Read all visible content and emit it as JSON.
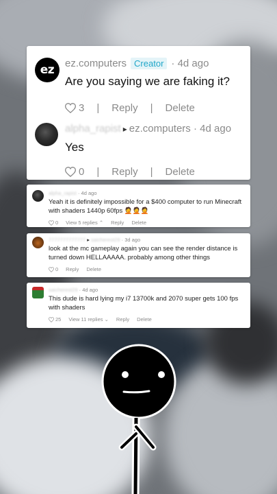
{
  "main_thread": {
    "author": {
      "username": "ez.computers",
      "badge": "Creator",
      "time": "4d ago",
      "avatar_text": "ez"
    },
    "comment": "Are you saying we are faking it?",
    "likes": "3",
    "reply_label": "Reply",
    "delete_label": "Delete",
    "reply": {
      "username": "alpha_rapist",
      "arrow": "▸",
      "reply_to": "ez.computers",
      "time": "4d ago",
      "text": "Yes",
      "likes": "0",
      "reply_label": "Reply",
      "delete_label": "Delete"
    }
  },
  "comments": [
    {
      "username": "alpha_rapist",
      "time": "4d ago",
      "text": "Yeah it is definitely impossible for a $400 computer to run Minecraft with shaders 1440p 60fps 🤦🤦🤦",
      "likes": "0",
      "replies_label": "View 5 replies",
      "reply_label": "Reply",
      "delete_label": "Delete"
    },
    {
      "username": "7777777777777",
      "arrow": "▸",
      "reply_to": "saicherest29",
      "time": "3d ago",
      "text": "look at the mc gameplay again you can see the render distance is turned down HELLAAAAA. probably among other things",
      "likes": "0",
      "reply_label": "Reply",
      "delete_label": "Delete"
    },
    {
      "username": "saicherest29",
      "time": "4d ago",
      "text": "This dude is hard lying my i7 13700k and 2070 super gets 100 fps with shaders",
      "likes": "25",
      "replies_label": "View 11 replies",
      "reply_label": "Reply",
      "delete_label": "Delete"
    }
  ],
  "colors": {
    "accent": "#21a7c9",
    "muted": "#8a8a8a",
    "card": "#ffffff"
  }
}
